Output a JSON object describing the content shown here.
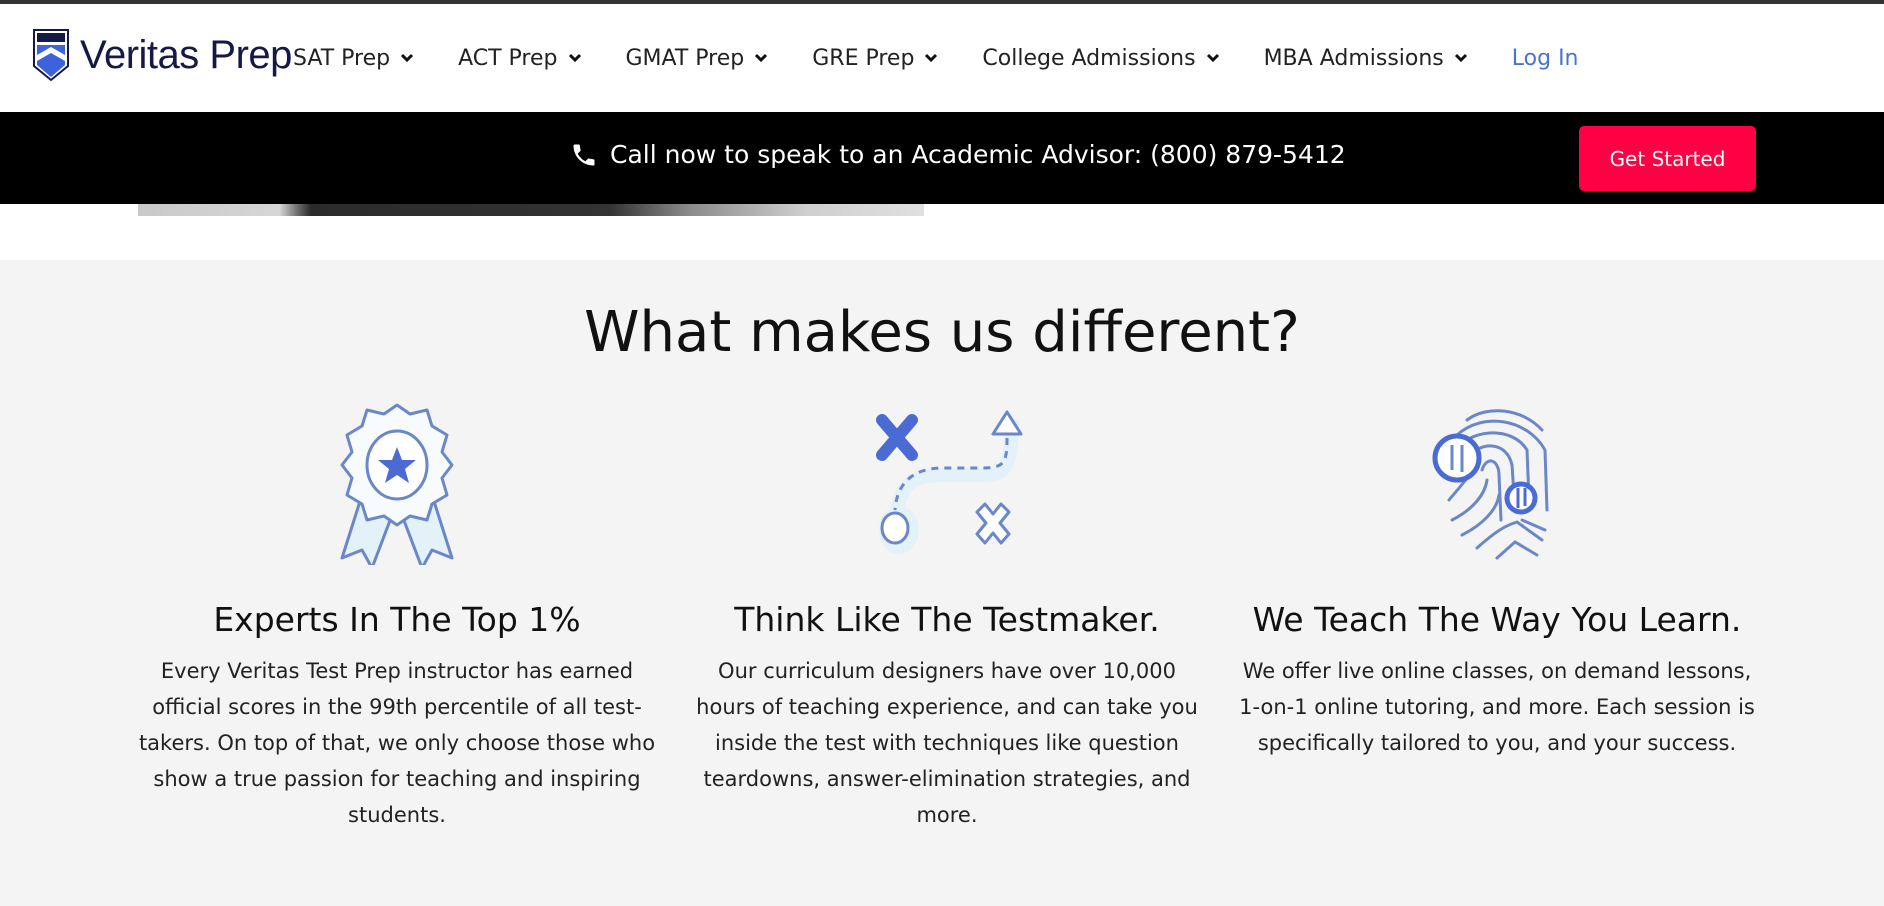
{
  "header": {
    "logo_text": "Veritas Prep",
    "nav": [
      {
        "label": "SAT Prep"
      },
      {
        "label": "ACT Prep"
      },
      {
        "label": "GMAT Prep"
      },
      {
        "label": "GRE Prep"
      },
      {
        "label": "College Admissions"
      },
      {
        "label": "MBA Admissions"
      }
    ],
    "login": "Log In"
  },
  "callbar": {
    "text": "Call now to speak to an Academic Advisor: (800) 879-5412",
    "cta": "Get Started",
    "cta_color": "#ff0045"
  },
  "section": {
    "title": "What makes us different?",
    "features": [
      {
        "icon": "award-ribbon-icon",
        "heading": "Experts In The Top 1%",
        "text": "Every Veritas Test Prep instructor has earned official scores in the 99th percentile of all test-takers. On top of that, we only choose those who show a true passion for teaching and inspiring students."
      },
      {
        "icon": "strategy-play-icon",
        "heading": "Think Like The Testmaker.",
        "text": "Our curriculum designers have over 10,000 hours of teaching experience, and can take you inside the test with techniques like question teardowns, answer-elimination strategies, and more."
      },
      {
        "icon": "fingerprint-icon",
        "heading": "We Teach The Way You Learn.",
        "text": "We offer live online classes, on demand lessons, 1-on-1 online tutoring, and more. Each session is specifically tailored to you, and your success."
      }
    ]
  },
  "colors": {
    "icon_line": "#6a87c7",
    "icon_fill": "#4b6bd4",
    "link": "#4a72d0"
  }
}
